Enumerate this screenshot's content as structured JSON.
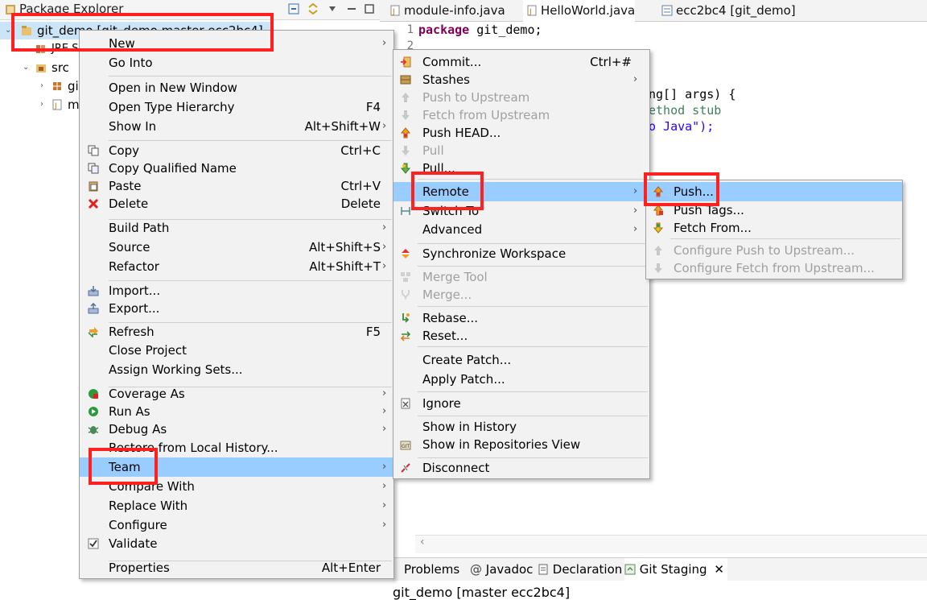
{
  "explorer": {
    "title": "Package Explorer",
    "project_label": "git_demo [git_demo master ecc2bc4]",
    "jre_label": "JRE S",
    "src_label": "src",
    "pkg_label": "gi",
    "module_label": "m"
  },
  "editor": {
    "tabs": [
      "module-info.java",
      "HelloWorld.java",
      "ecc2bc4 [git_demo]"
    ],
    "line_numbers": [
      "1",
      "2"
    ],
    "code": {
      "line1_kw": "package",
      "line1_rest": " git_demo;",
      "args_kw": "ng[] args",
      "args_rest": ") {",
      "stub": "ethod stub",
      "java": "o Java\");"
    }
  },
  "context_menu": {
    "items": [
      {
        "label": "New",
        "shortcut": "",
        "submenu": true
      },
      {
        "label": "Go Into",
        "shortcut": "",
        "submenu": false
      },
      {
        "label": "Open in New Window",
        "shortcut": "",
        "submenu": false
      },
      {
        "label": "Open Type Hierarchy",
        "shortcut": "F4",
        "submenu": false
      },
      {
        "label": "Show In",
        "shortcut": "Alt+Shift+W",
        "submenu": true
      },
      {
        "label": "Copy",
        "shortcut": "Ctrl+C",
        "submenu": false
      },
      {
        "label": "Copy Qualified Name",
        "shortcut": "",
        "submenu": false
      },
      {
        "label": "Paste",
        "shortcut": "Ctrl+V",
        "submenu": false
      },
      {
        "label": "Delete",
        "shortcut": "Delete",
        "submenu": false
      },
      {
        "label": "Build Path",
        "shortcut": "",
        "submenu": true
      },
      {
        "label": "Source",
        "shortcut": "Alt+Shift+S",
        "submenu": true
      },
      {
        "label": "Refactor",
        "shortcut": "Alt+Shift+T",
        "submenu": true
      },
      {
        "label": "Import...",
        "shortcut": "",
        "submenu": false
      },
      {
        "label": "Export...",
        "shortcut": "",
        "submenu": false
      },
      {
        "label": "Refresh",
        "shortcut": "F5",
        "submenu": false
      },
      {
        "label": "Close Project",
        "shortcut": "",
        "submenu": false
      },
      {
        "label": "Assign Working Sets...",
        "shortcut": "",
        "submenu": false
      },
      {
        "label": "Coverage As",
        "shortcut": "",
        "submenu": true
      },
      {
        "label": "Run As",
        "shortcut": "",
        "submenu": true
      },
      {
        "label": "Debug As",
        "shortcut": "",
        "submenu": true
      },
      {
        "label": "Restore from Local History...",
        "shortcut": "",
        "submenu": false
      },
      {
        "label": "Team",
        "shortcut": "",
        "submenu": true
      },
      {
        "label": "Compare With",
        "shortcut": "",
        "submenu": true
      },
      {
        "label": "Replace With",
        "shortcut": "",
        "submenu": true
      },
      {
        "label": "Configure",
        "shortcut": "",
        "submenu": true
      },
      {
        "label": "Validate",
        "shortcut": "",
        "submenu": false
      },
      {
        "label": "Properties",
        "shortcut": "Alt+Enter",
        "submenu": false
      }
    ]
  },
  "team_menu": {
    "items": [
      {
        "label": "Commit...",
        "shortcut": "Ctrl+#",
        "submenu": false
      },
      {
        "label": "Stashes",
        "shortcut": "",
        "submenu": true
      },
      {
        "label": "Push to Upstream",
        "shortcut": "",
        "submenu": false
      },
      {
        "label": "Fetch from Upstream",
        "shortcut": "",
        "submenu": false
      },
      {
        "label": "Push HEAD...",
        "shortcut": "",
        "submenu": false
      },
      {
        "label": "Pull",
        "shortcut": "",
        "submenu": false
      },
      {
        "label": "Pull...",
        "shortcut": "",
        "submenu": false
      },
      {
        "label": "Remote",
        "shortcut": "",
        "submenu": true
      },
      {
        "label": "Switch To",
        "shortcut": "",
        "submenu": true
      },
      {
        "label": "Advanced",
        "shortcut": "",
        "submenu": true
      },
      {
        "label": "Synchronize Workspace",
        "shortcut": "",
        "submenu": false
      },
      {
        "label": "Merge Tool",
        "shortcut": "",
        "submenu": false
      },
      {
        "label": "Merge...",
        "shortcut": "",
        "submenu": false
      },
      {
        "label": "Rebase...",
        "shortcut": "",
        "submenu": false
      },
      {
        "label": "Reset...",
        "shortcut": "",
        "submenu": false
      },
      {
        "label": "Create Patch...",
        "shortcut": "",
        "submenu": false
      },
      {
        "label": "Apply Patch...",
        "shortcut": "",
        "submenu": false
      },
      {
        "label": "Ignore",
        "shortcut": "",
        "submenu": false
      },
      {
        "label": "Show in History",
        "shortcut": "",
        "submenu": false
      },
      {
        "label": "Show in Repositories View",
        "shortcut": "",
        "submenu": false
      },
      {
        "label": "Disconnect",
        "shortcut": "",
        "submenu": false
      }
    ]
  },
  "remote_menu": {
    "items": [
      {
        "label": "Push..."
      },
      {
        "label": "Push Tags..."
      },
      {
        "label": "Fetch From..."
      },
      {
        "label": "Configure Push to Upstream..."
      },
      {
        "label": "Configure Fetch from Upstream..."
      }
    ]
  },
  "bottom_panel": {
    "tabs": [
      "Problems",
      "Javadoc",
      "Declaration",
      "Git Staging"
    ],
    "staging_title": "git_demo [master ecc2bc4]"
  },
  "colors": {
    "highlight": "#99ccff",
    "selection": "#cce4f7",
    "annotation_red": "#ff2020",
    "keyword": "#7f0055",
    "comment": "#3f7f5f",
    "string": "#2a00ff"
  }
}
